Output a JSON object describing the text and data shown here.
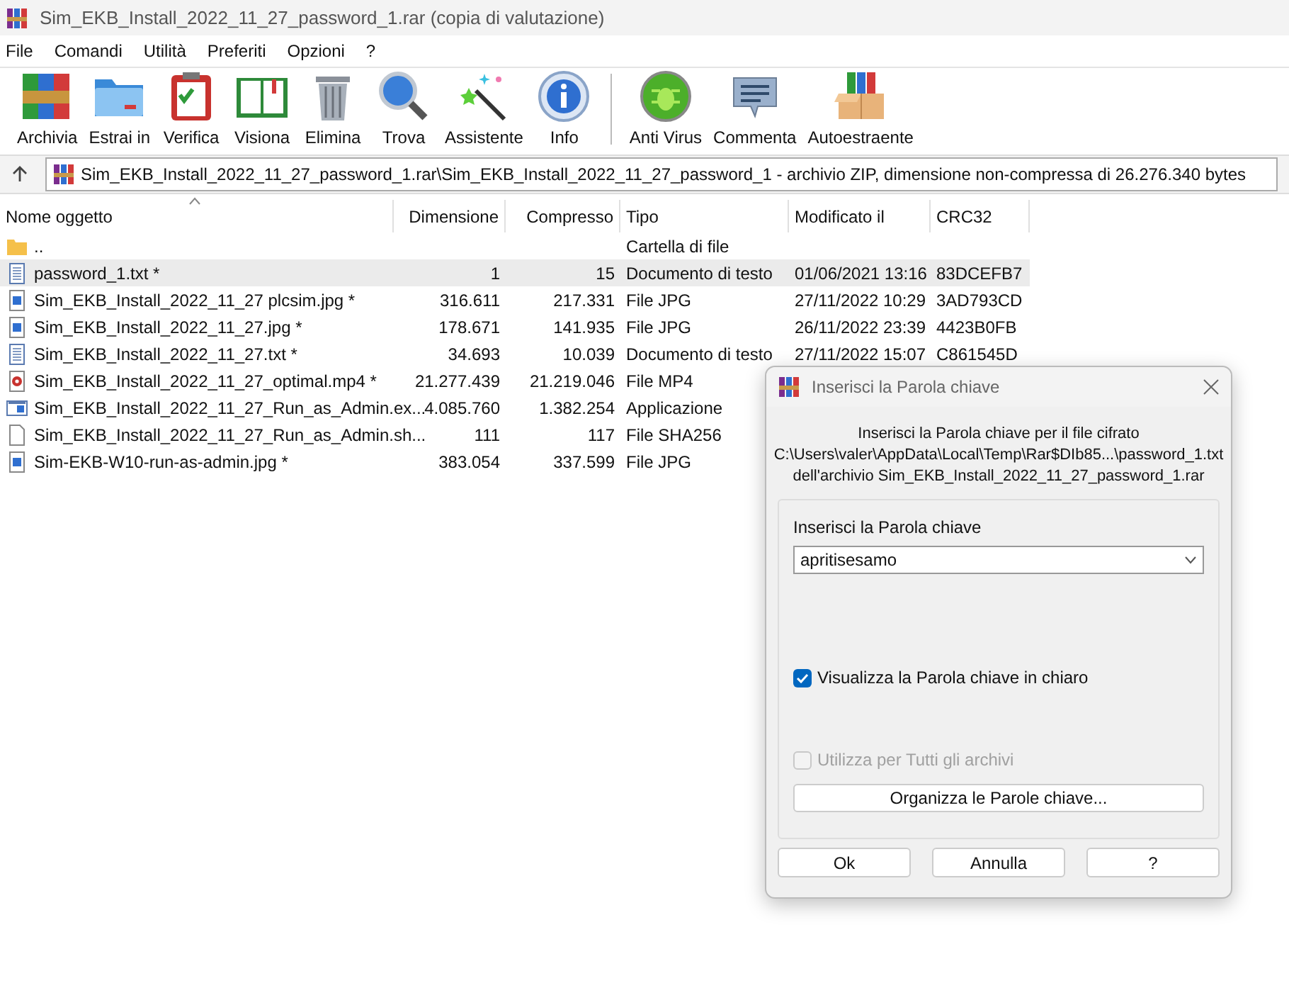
{
  "window": {
    "title": "Sim_EKB_Install_2022_11_27_password_1.rar (copia di valutazione)"
  },
  "menu": [
    "File",
    "Comandi",
    "Utilità",
    "Preferiti",
    "Opzioni",
    "?"
  ],
  "toolbar": [
    {
      "label": "Archivia",
      "kind": "books"
    },
    {
      "label": "Estrai in",
      "kind": "folder"
    },
    {
      "label": "Verifica",
      "kind": "clipboard"
    },
    {
      "label": "Visiona",
      "kind": "book"
    },
    {
      "label": "Elimina",
      "kind": "trash"
    },
    {
      "label": "Trova",
      "kind": "magnifier"
    },
    {
      "label": "Assistente",
      "kind": "wand"
    },
    {
      "label": "Info",
      "kind": "info"
    },
    {
      "label": "Anti Virus",
      "kind": "bug"
    },
    {
      "label": "Commenta",
      "kind": "comment"
    },
    {
      "label": "Autoestraente",
      "kind": "box"
    }
  ],
  "address": "Sim_EKB_Install_2022_11_27_password_1.rar\\Sim_EKB_Install_2022_11_27_password_1 - archivio ZIP, dimensione non-compressa di 26.276.340 bytes",
  "table": {
    "columns": [
      "Nome oggetto",
      "Dimensione",
      "Compresso",
      "Tipo",
      "Modificato il",
      "CRC32"
    ],
    "rows": [
      {
        "kind": "folder",
        "name": "..",
        "size": "",
        "packed": "",
        "type": "Cartella di file",
        "modified": "",
        "crc": "",
        "selected": false
      },
      {
        "kind": "text",
        "name": "password_1.txt *",
        "size": "1",
        "packed": "15",
        "type": "Documento di testo",
        "modified": "01/06/2021 13:16",
        "crc": "83DCEFB7",
        "selected": true
      },
      {
        "kind": "image",
        "name": "Sim_EKB_Install_2022_11_27 plcsim.jpg *",
        "size": "316.611",
        "packed": "217.331",
        "type": "File JPG",
        "modified": "27/11/2022 10:29",
        "crc": "3AD793CD",
        "selected": false
      },
      {
        "kind": "image",
        "name": "Sim_EKB_Install_2022_11_27.jpg *",
        "size": "178.671",
        "packed": "141.935",
        "type": "File JPG",
        "modified": "26/11/2022 23:39",
        "crc": "4423B0FB",
        "selected": false
      },
      {
        "kind": "text",
        "name": "Sim_EKB_Install_2022_11_27.txt *",
        "size": "34.693",
        "packed": "10.039",
        "type": "Documento di testo",
        "modified": "27/11/2022 15:07",
        "crc": "C861545D",
        "selected": false
      },
      {
        "kind": "video",
        "name": "Sim_EKB_Install_2022_11_27_optimal.mp4 *",
        "size": "21.277.439",
        "packed": "21.219.046",
        "type": "File MP4",
        "modified": "",
        "crc": "",
        "selected": false
      },
      {
        "kind": "app",
        "name": "Sim_EKB_Install_2022_11_27_Run_as_Admin.ex...",
        "size": "4.085.760",
        "packed": "1.382.254",
        "type": "Applicazione",
        "modified": "",
        "crc": "",
        "selected": false
      },
      {
        "kind": "blank",
        "name": "Sim_EKB_Install_2022_11_27_Run_as_Admin.sh...",
        "size": "111",
        "packed": "117",
        "type": "File SHA256",
        "modified": "",
        "crc": "",
        "selected": false
      },
      {
        "kind": "image",
        "name": "Sim-EKB-W10-run-as-admin.jpg *",
        "size": "383.054",
        "packed": "337.599",
        "type": "File JPG",
        "modified": "",
        "crc": "",
        "selected": false
      }
    ]
  },
  "dialog": {
    "title": "Inserisci la Parola chiave",
    "message": [
      "Inserisci la Parola chiave per il file cifrato",
      "C:\\Users\\valer\\AppData\\Local\\Temp\\Rar$DIb85...\\password_1.txt",
      "dell'archivio Sim_EKB_Install_2022_11_27_password_1.rar"
    ],
    "field_label": "Inserisci la Parola chiave",
    "field_value": "apritisesamo",
    "show_password": {
      "label": "Visualizza la Parola chiave in chiaro",
      "checked": true,
      "disabled": false
    },
    "use_all": {
      "label": "Utilizza per Tutti gli archivi",
      "checked": false,
      "disabled": true
    },
    "organize_button": "Organizza le Parole chiave...",
    "buttons": [
      "Ok",
      "Annulla",
      "?"
    ]
  }
}
